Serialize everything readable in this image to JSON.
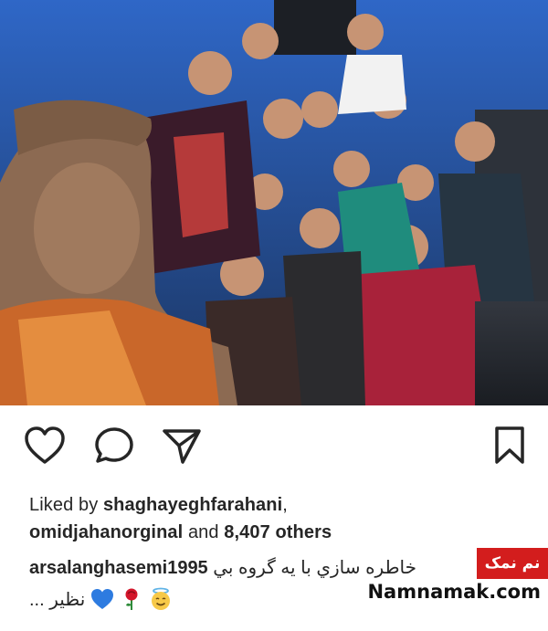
{
  "post": {
    "photo_alt": "group-selfie-photo"
  },
  "actions": {
    "like_icon": "heart-icon",
    "comment_icon": "comment-icon",
    "share_icon": "send-icon",
    "save_icon": "bookmark-icon"
  },
  "likes": {
    "prefix": "Liked by ",
    "user1": "shaghayeghfarahani",
    "sep": ",",
    "user2": "omidjahanorginal",
    "and_text": " and ",
    "count": "8,407 others"
  },
  "caption": {
    "username": "arsalanghasemi1995",
    "text": "خاطره سازي با يه گروه بي",
    "text_line2": "نظير ...",
    "emojis": [
      "blue-heart",
      "rose",
      "smiling-face-with-halo"
    ]
  },
  "watermark": {
    "badge": "نم نمک",
    "site": "Namnamak.com"
  },
  "colors": {
    "badge_bg": "#d31d1d",
    "heart_blue": "#2d7be0",
    "text": "#262626"
  }
}
